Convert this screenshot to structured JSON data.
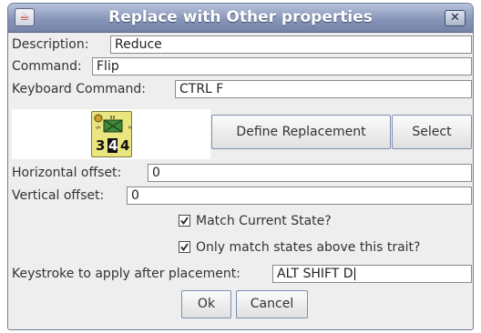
{
  "window": {
    "title": "Replace with Other properties",
    "icon": "java-cup-icon",
    "close_glyph": "✕"
  },
  "form": {
    "description": {
      "label": "Description:",
      "value": "Reduce"
    },
    "command": {
      "label": "Command:",
      "value": "Flip"
    },
    "keyboard_command": {
      "label": "Keyboard Command:",
      "value": "CTRL F"
    },
    "piece_preview": {
      "icon": "counter-piece-icon",
      "left_number": "3",
      "center_number": "4",
      "right_number": "4"
    },
    "define_replacement_label": "Define Replacement",
    "select_label": "Select",
    "horizontal_offset": {
      "label": "Horizontal offset:",
      "value": "0"
    },
    "vertical_offset": {
      "label": "Vertical offset:",
      "value": "0"
    },
    "match_current_state": {
      "label": "Match Current State?",
      "checked": true
    },
    "only_match_above": {
      "label": "Only match states above this trait?",
      "checked": true
    },
    "keystroke_after": {
      "label": "Keystroke to apply after placement:",
      "value": "ALT SHIFT D"
    }
  },
  "buttons": {
    "ok_label": "Ok",
    "cancel_label": "Cancel"
  }
}
